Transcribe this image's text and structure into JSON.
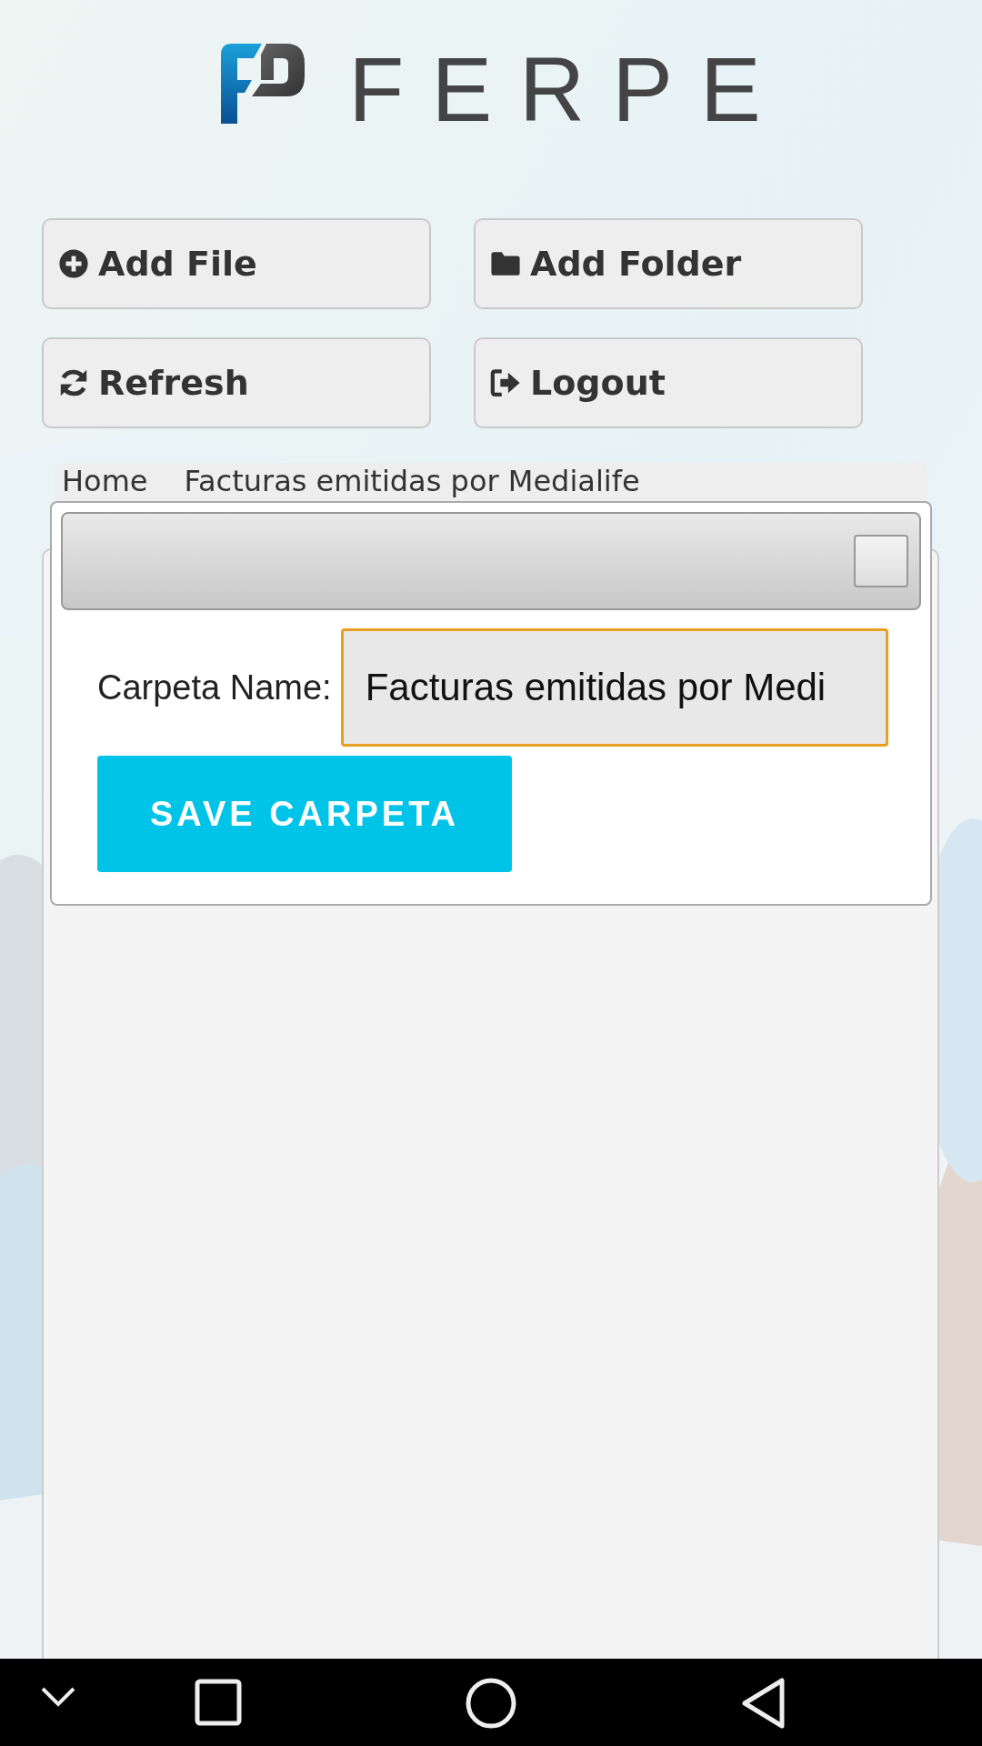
{
  "logo": {
    "text": "FERPE"
  },
  "buttons": [
    {
      "label": "Add File",
      "kind": "add"
    },
    {
      "label": "Add Folder",
      "kind": "folder"
    },
    {
      "label": "Refresh",
      "kind": "refresh"
    },
    {
      "label": "Logout",
      "kind": "logout"
    }
  ],
  "breadcrumb": [
    "Home",
    "Facturas emitidas por Medialife"
  ],
  "dialog": {
    "field_label": "Carpeta Name:",
    "field_value": "Facturas emitidas por Medi",
    "save_button": "SAVE CARPETA"
  }
}
